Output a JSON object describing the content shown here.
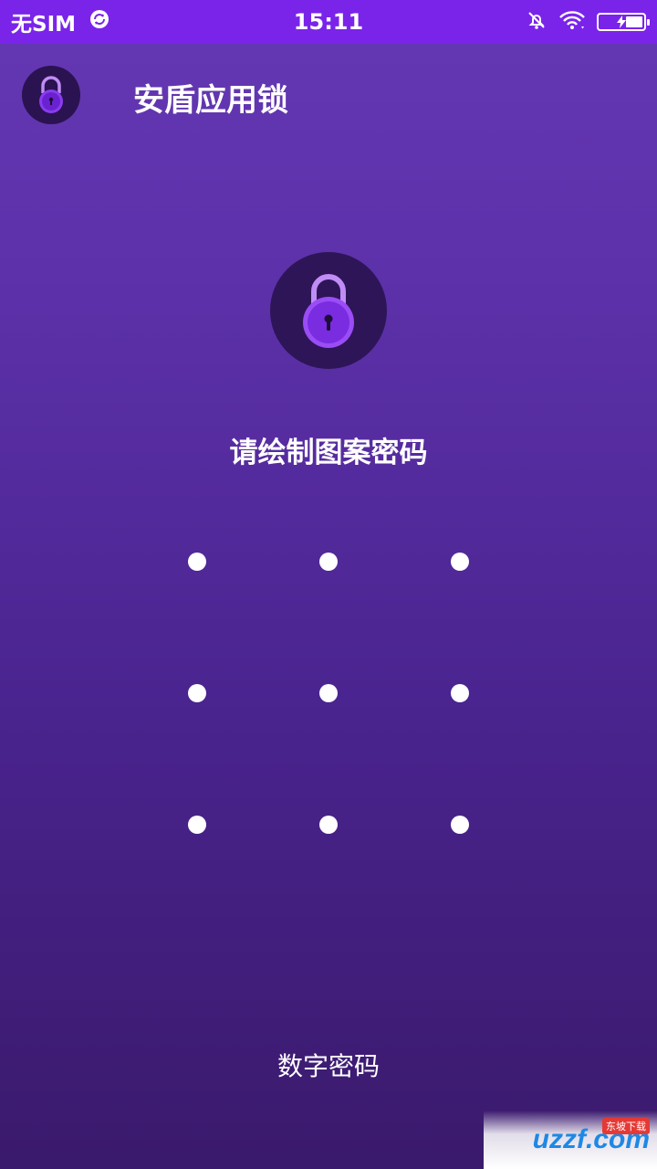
{
  "status_bar": {
    "carrier": "无SIM",
    "time": "15:11",
    "icons": [
      "sync-icon",
      "bell-off-icon",
      "wifi-icon",
      "battery-charging-icon"
    ]
  },
  "app_bar": {
    "title": "安盾应用锁",
    "logo_icon": "padlock-icon"
  },
  "lock_screen": {
    "icon": "padlock-icon",
    "prompt": "请绘制图案密码",
    "pattern_dots": 9,
    "switch_label": "数字密码"
  },
  "watermark": {
    "text": "uzzf.com",
    "sub": "东坡下载"
  },
  "colors": {
    "status_bar": "#7a24ea",
    "background_top": "#6538b4",
    "background_bottom": "#3a1a6c",
    "lock_circle": "#2e1557",
    "lock_purple": "#8a3cf0"
  }
}
